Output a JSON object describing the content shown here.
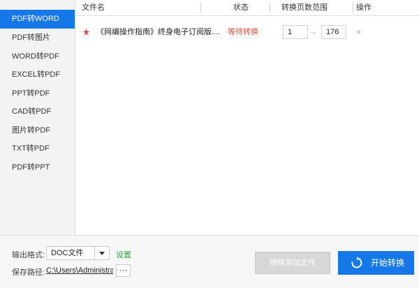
{
  "sidebar": {
    "items": [
      {
        "label": "PDF转WORD",
        "active": true
      },
      {
        "label": "PDF转图片"
      },
      {
        "label": "WORD转PDF"
      },
      {
        "label": "EXCEL转PDF"
      },
      {
        "label": "PPT转PDF"
      },
      {
        "label": "CAD转PDF"
      },
      {
        "label": "图片转PDF"
      },
      {
        "label": "TXT转PDF"
      },
      {
        "label": "PDF转PPT"
      }
    ]
  },
  "table": {
    "headers": {
      "name": "文件名",
      "status": "状态",
      "range": "转换页数范围",
      "action": "操作"
    },
    "rows": [
      {
        "name": "《网编操作指南》终身电子订阅版....",
        "status": "等待转换",
        "start_page": "1",
        "end_page": "176"
      }
    ],
    "arrow": "→",
    "delete": "×"
  },
  "footer": {
    "format_label": "输出格式:",
    "format_value": "DOC文件",
    "settings_label": "设置",
    "path_label": "保存路径:",
    "path_value": "C:\\Users\\Administrat",
    "browse_label": "···",
    "add_button": "继续添加文件",
    "start_button": "开始转换"
  },
  "colors": {
    "accent": "#1677e8",
    "status": "#e34a3b",
    "settings": "#2eaa3a"
  }
}
